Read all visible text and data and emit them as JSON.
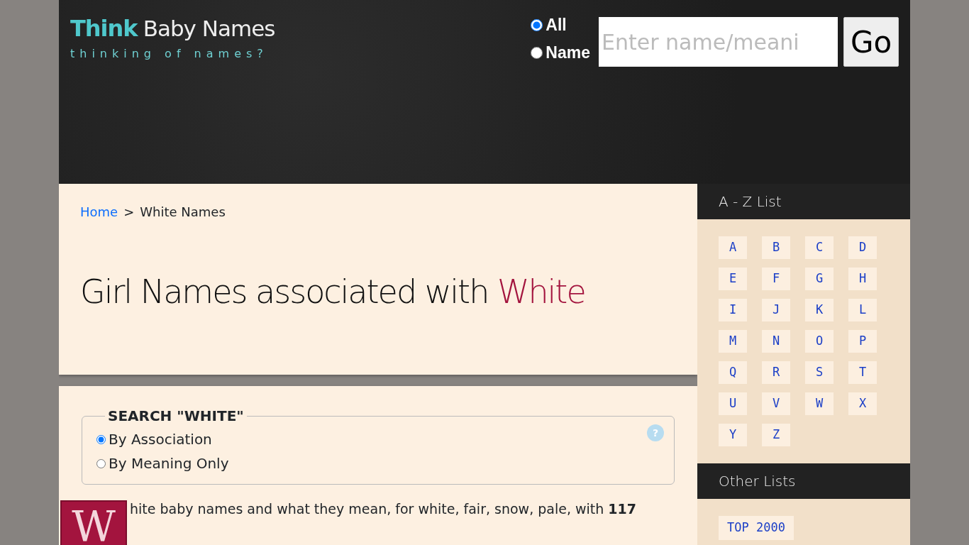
{
  "header": {
    "logo": {
      "brand": "Think",
      "rest": "Baby Names",
      "tagline": "thinking of names?"
    },
    "search": {
      "modes": [
        {
          "label": "All",
          "selected": true
        },
        {
          "label": "Name",
          "selected": false
        }
      ],
      "placeholder": "Enter name/meani",
      "button": "Go"
    }
  },
  "breadcrumb": [
    {
      "label": "Home",
      "kind": "link"
    },
    {
      "label": ">",
      "kind": "separator"
    },
    {
      "label": "White Names",
      "kind": "current"
    }
  ],
  "title": {
    "text": "Girl Names associated with",
    "highlight": "White"
  },
  "search_box": {
    "legend": "SEARCH \"WHITE\"",
    "help": "?",
    "options": [
      {
        "label": "By Association",
        "selected": true
      },
      {
        "label": "By Meaning Only",
        "selected": false
      }
    ]
  },
  "intro": {
    "initial": "W",
    "text": "hite baby names and what they mean, for white, fair, snow, pale, with **117**"
  },
  "sidebar": {
    "az_title": "A - Z List",
    "letters": [
      "A",
      "B",
      "C",
      "D",
      "E",
      "F",
      "G",
      "H",
      "I",
      "J",
      "K",
      "L",
      "M",
      "N",
      "O",
      "P",
      "Q",
      "R",
      "S",
      "T",
      "U",
      "V",
      "W",
      "X",
      "Y",
      "Z"
    ],
    "other_title": "Other Lists",
    "other": [
      "TOP 2000"
    ]
  }
}
